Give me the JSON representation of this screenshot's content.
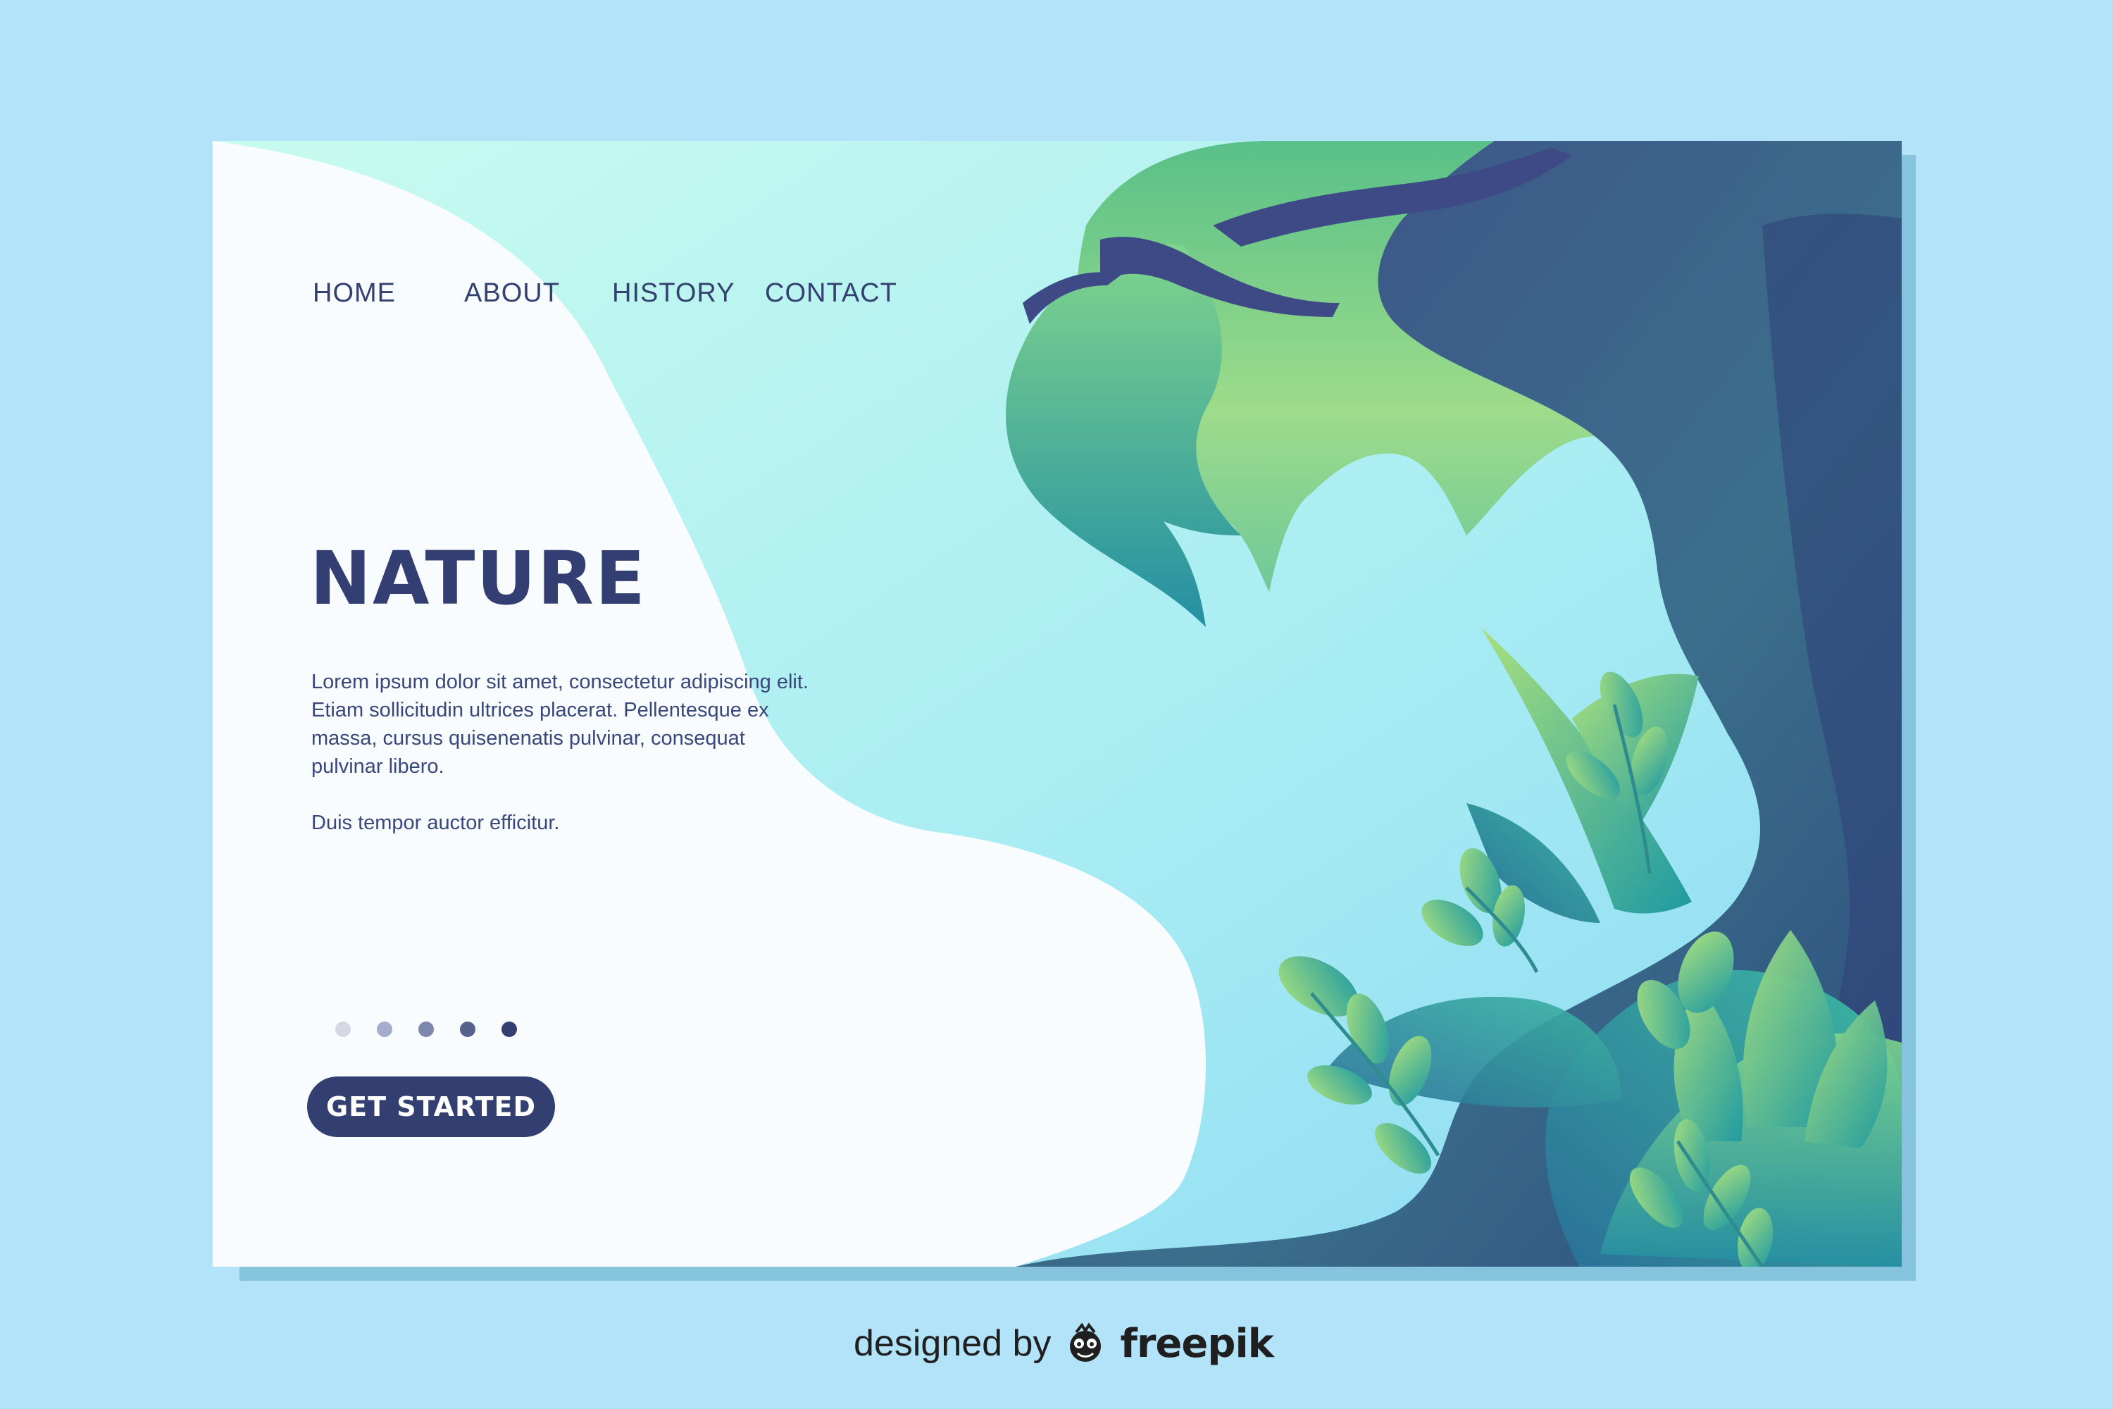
{
  "nav": {
    "items": [
      {
        "label": "HOME"
      },
      {
        "label": "ABOUT"
      },
      {
        "label": "HISTORY"
      },
      {
        "label": "CONTACT"
      }
    ]
  },
  "hero": {
    "title": "NATURE",
    "paragraph1": "Lorem ipsum dolor sit amet, consectetur adipiscing elit. Etiam sollicitudin ultrices placerat. Pellentesque ex massa, cursus quisenenatis pulvinar, consequat pulvinar libero.",
    "paragraph2": "Duis tempor auctor efficitur.",
    "cta_label": "GET STARTED"
  },
  "slider": {
    "count": 5,
    "active_index": 4,
    "colors": [
      "#d3d8e4",
      "#a4accb",
      "#7d87ab",
      "#56628d",
      "#323f70"
    ]
  },
  "credit": {
    "prefix": "designed by",
    "brand": "freepik",
    "logo_icon": "freepik-logo-icon"
  },
  "colors": {
    "page_background": "#b3e3f9",
    "accent": "#323f70",
    "heading": "#333f72"
  }
}
